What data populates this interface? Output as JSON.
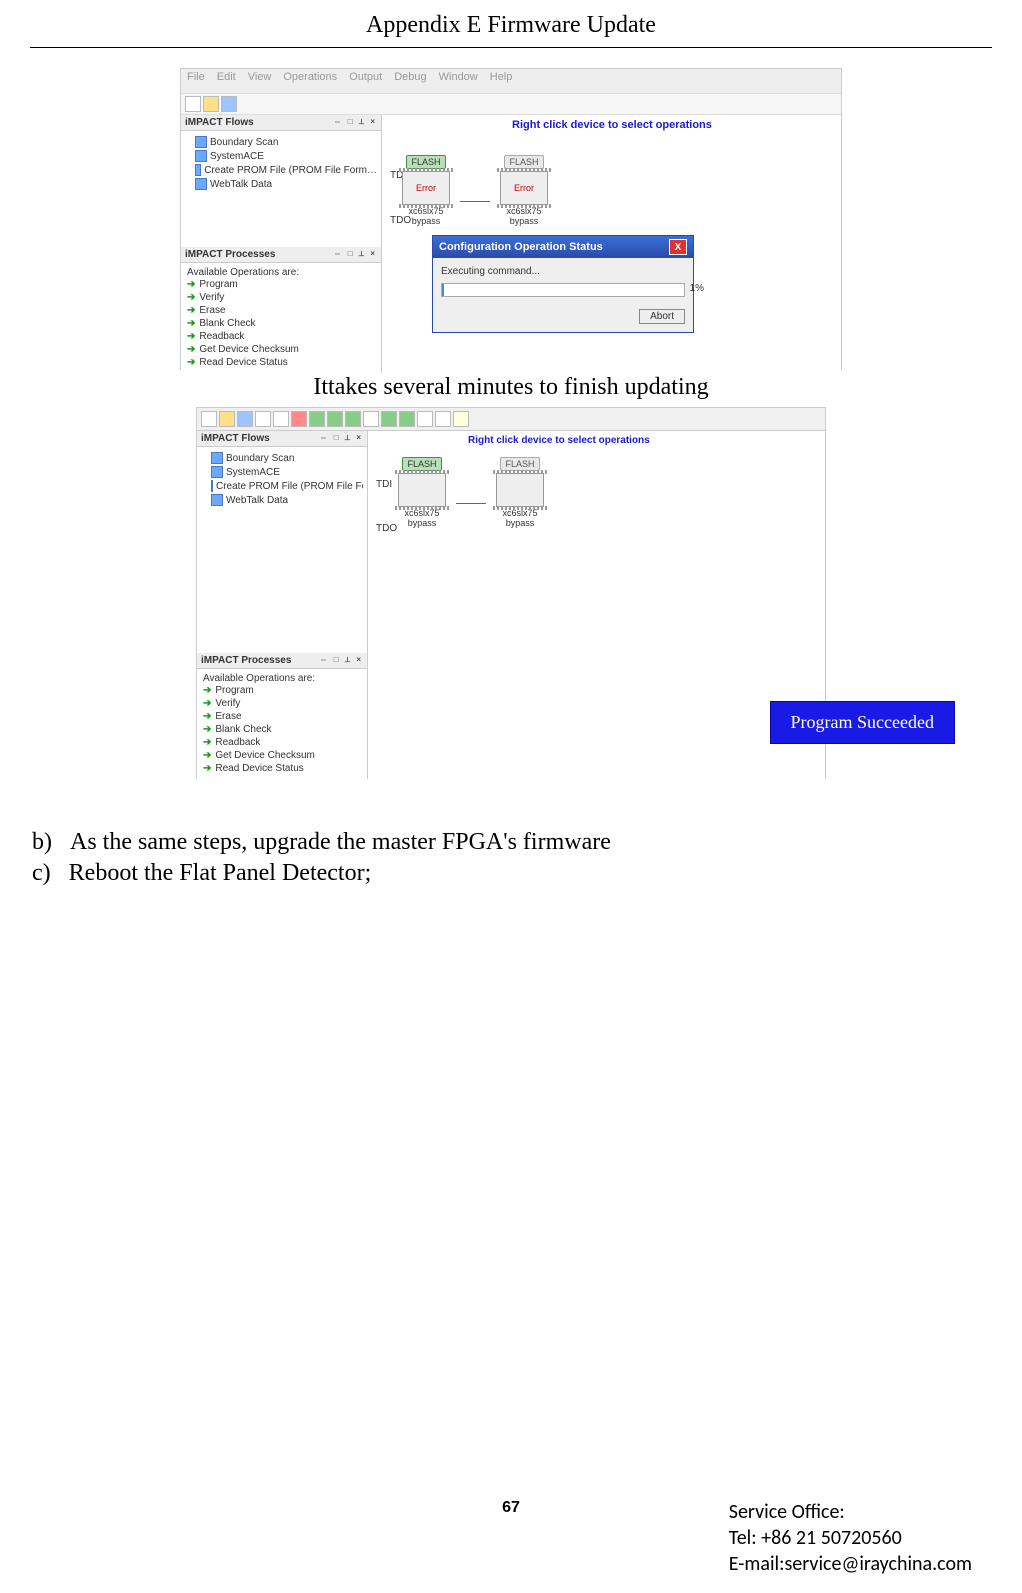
{
  "header": {
    "title": "Appendix E Firmware Update"
  },
  "fig1": {
    "menu": [
      "File",
      "Edit",
      "View",
      "Operations",
      "Output",
      "Debug",
      "Window",
      "Help"
    ],
    "flows_title": "iMPACT Flows",
    "tree": [
      "Boundary Scan",
      "SystemACE",
      "Create PROM File (PROM File Form…",
      "WebTalk Data"
    ],
    "proc_title": "iMPACT Processes",
    "ops_header": "Available Operations are:",
    "ops": [
      "Program",
      "Verify",
      "Erase",
      "Blank Check",
      "Readback",
      "Get Device Checksum",
      "Read Device Status"
    ],
    "hint": "Right click device to select operations",
    "chip1_tag": "FLASH",
    "chip2_tag": "FLASH",
    "chip_err": "Error",
    "chip1_name": "xc6slx75",
    "chip1_sub": "bypass",
    "chip2_name": "xc6slx75",
    "chip2_sub": "bypass",
    "tdi": "TDI",
    "tdo": "TDO",
    "dialog_title": "Configuration Operation Status",
    "dialog_msg": "Executing command...",
    "dialog_pct": "1%",
    "dialog_abort": "Abort"
  },
  "caption1": "Ittakes several minutes to finish updating",
  "fig2": {
    "flows_title": "iMPACT Flows",
    "tree": [
      "Boundary Scan",
      "SystemACE",
      "Create PROM File (PROM File Form…",
      "WebTalk Data"
    ],
    "proc_title": "iMPACT Processes",
    "ops_header": "Available Operations are:",
    "ops": [
      "Program",
      "Verify",
      "Erase",
      "Blank Check",
      "Readback",
      "Get Device Checksum",
      "Read Device Status"
    ],
    "hint": "Right click device to select operations",
    "chip1_tag": "FLASH",
    "chip2_tag": "FLASH",
    "chip1_name": "xc6slx75",
    "chip1_sub": "bypass",
    "chip2_name": "xc6slx75",
    "chip2_sub": "bypass",
    "tdi": "TDI",
    "tdo": "TDO",
    "success": "Program Succeeded"
  },
  "steps": {
    "b_marker": "b)",
    "b_text": "As the same steps, upgrade the master FPGA's firmware",
    "c_marker": "c)",
    "c_text": "Reboot the Flat Panel Detector;"
  },
  "page_number": "67",
  "footer": {
    "office": "Service Office:",
    "tel": "Tel: +86 21 50720560",
    "email": "E-mail:service@iraychina.com"
  }
}
